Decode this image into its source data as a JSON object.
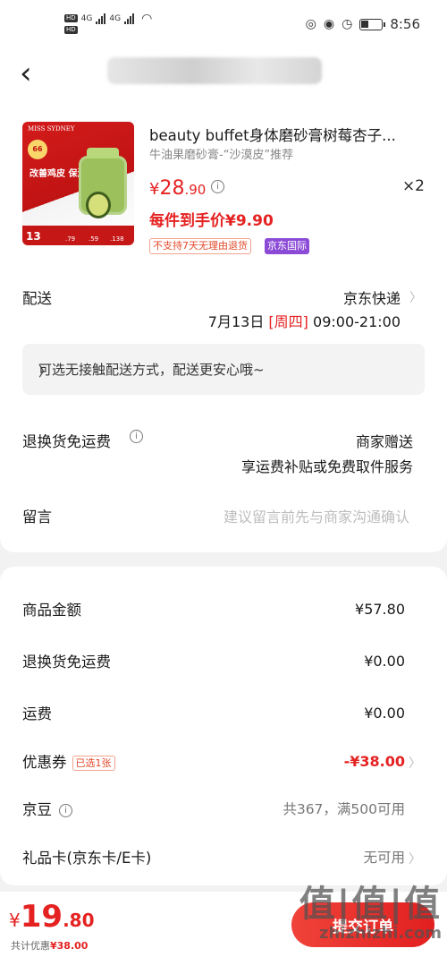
{
  "status_bar": {
    "time": "8:56"
  },
  "navbar": {
    "back_icon": "‹"
  },
  "product": {
    "image_text": {
      "brand": "MISS SYDNEY",
      "badge": "66",
      "headline": "改善鸡皮 保湿修复",
      "prices": [
        ".79",
        ".59",
        ".138"
      ],
      "big_num": "13"
    },
    "title": "beauty buffet身体磨砂膏树莓杏子...",
    "subtitle": "牛油果磨砂膏-“沙漠皮”推荐",
    "price_currency": "¥",
    "price_int": "28",
    "price_dec": ".90",
    "quantity": "×2",
    "unit_price": "每件到手价¥9.90",
    "tags": [
      "不支持7天无理由退货",
      "京东国际"
    ]
  },
  "delivery": {
    "label": "配送",
    "method": "京东快递",
    "date": "7月13日 ",
    "weekday": "[周四]",
    "time": " 09:00-21:00",
    "contactless_notice": "可选无接触配送方式，配送更安心哦~"
  },
  "return_shipping": {
    "label": "退换货免运费",
    "value1": "商家赠送",
    "value2": "享运费补贴或免费取件服务"
  },
  "message": {
    "label": "留言",
    "placeholder": "建议留言前先与商家沟通确认"
  },
  "summary": {
    "goods_label": "商品金额",
    "goods_value": "¥57.80",
    "return_label": "退换货免运费",
    "return_value": "¥0.00",
    "freight_label": "运费",
    "freight_value": "¥0.00",
    "coupon_label": "优惠券",
    "coupon_tag": "已选1张",
    "coupon_value": "-¥38.00",
    "jdbean_label": "京豆",
    "jdbean_value": "共367，满500可用",
    "giftcard_label": "礼品卡(京东卡/E卡)",
    "giftcard_value": "无可用"
  },
  "bottom": {
    "currency": "¥",
    "total_int": "19",
    "total_dec": ".80",
    "discount_prefix": "共计优惠",
    "discount_amount": "¥38.00",
    "submit_label": "提交订单"
  },
  "watermark": {
    "line1": "值|值|值",
    "line2": "zhizhizhi.com"
  },
  "colors": {
    "accent": "#e52222",
    "tag_purple": "#8c4bd6"
  }
}
